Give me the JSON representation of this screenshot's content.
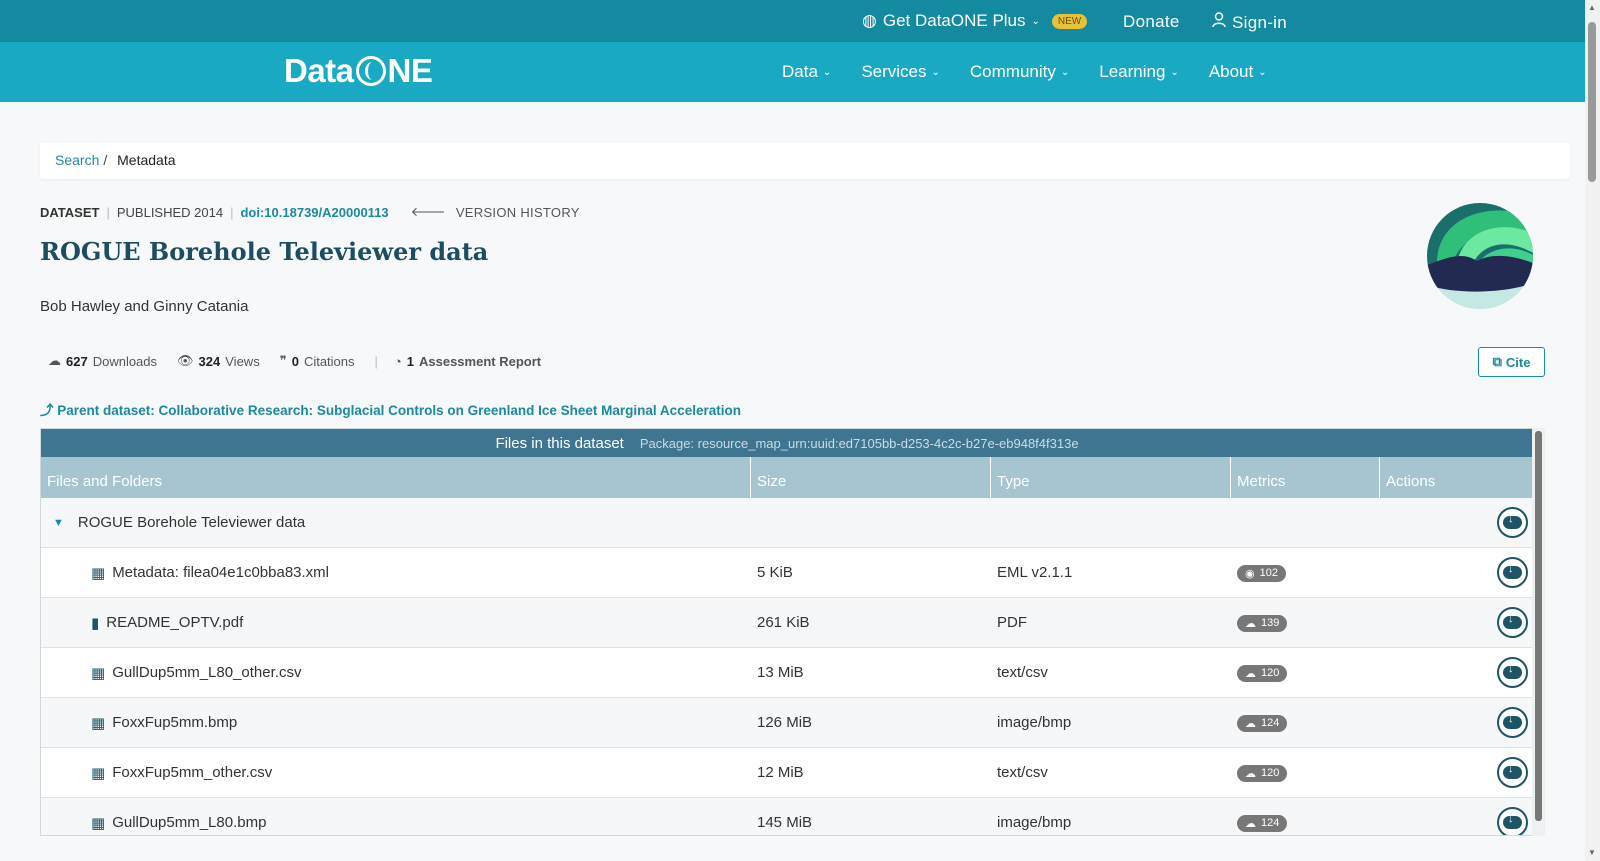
{
  "topbar": {
    "plus_label": "Get DataONE Plus",
    "new_badge": "NEW",
    "donate": "Donate",
    "signin": "Sign-in"
  },
  "nav": {
    "logo_a": "Data",
    "logo_b": "NE",
    "items": [
      "Data",
      "Services",
      "Community",
      "Learning",
      "About"
    ]
  },
  "breadcrumb": {
    "search": "Search",
    "sep": "/",
    "current": "Metadata"
  },
  "dataset": {
    "type": "DATASET",
    "published": "PUBLISHED 2014",
    "doi": "doi:10.18739/A20000113",
    "version_history": "VERSION HISTORY",
    "title": "ROGUE Borehole Televiewer data",
    "authors": "Bob Hawley and Ginny Catania",
    "downloads_count": "627",
    "downloads_label": "Downloads",
    "views_count": "324",
    "views_label": "Views",
    "citations_count": "0",
    "citations_label": "Citations",
    "assessment_count": "1",
    "assessment_label": "Assessment Report",
    "cite": "Cite",
    "parent": "Parent dataset: Collaborative Research: Subglacial Controls on Greenland Ice Sheet Marginal Acceleration"
  },
  "files": {
    "header": "Files in this dataset",
    "package": "Package: resource_map_urn:uuid:ed7105bb-d253-4c2c-b27e-eb948f4f313e",
    "columns": [
      "Files and Folders",
      "Size",
      "Type",
      "Metrics",
      "Actions"
    ],
    "folder": "ROGUE Borehole Televiewer data",
    "rows": [
      {
        "name": "Metadata: filea04e1c0bba83.xml",
        "size": "5 KiB",
        "type": "EML v2.1.1",
        "metric": "102",
        "icon": "table-icon",
        "metric_icon": "eye-icon"
      },
      {
        "name": "README_OPTV.pdf",
        "size": "261 KiB",
        "type": "PDF",
        "metric": "139",
        "icon": "file-icon",
        "metric_icon": "cloud-download-icon"
      },
      {
        "name": "GullDup5mm_L80_other.csv",
        "size": "13 MiB",
        "type": "text/csv",
        "metric": "120",
        "icon": "table-icon",
        "metric_icon": "cloud-download-icon"
      },
      {
        "name": "FoxxFup5mm.bmp",
        "size": "126 MiB",
        "type": "image/bmp",
        "metric": "124",
        "icon": "table-icon",
        "metric_icon": "cloud-download-icon"
      },
      {
        "name": "FoxxFup5mm_other.csv",
        "size": "12 MiB",
        "type": "text/csv",
        "metric": "120",
        "icon": "table-icon",
        "metric_icon": "cloud-download-icon"
      },
      {
        "name": "GullDup5mm_L80.bmp",
        "size": "145 MiB",
        "type": "image/bmp",
        "metric": "124",
        "icon": "table-icon",
        "metric_icon": "cloud-download-icon"
      }
    ]
  },
  "colors": {
    "topbar": "#138aa0",
    "navbar": "#1aa9c2",
    "accent": "#1a8aa0",
    "table_header": "#3f7590",
    "column_header": "#a7c5d0"
  }
}
